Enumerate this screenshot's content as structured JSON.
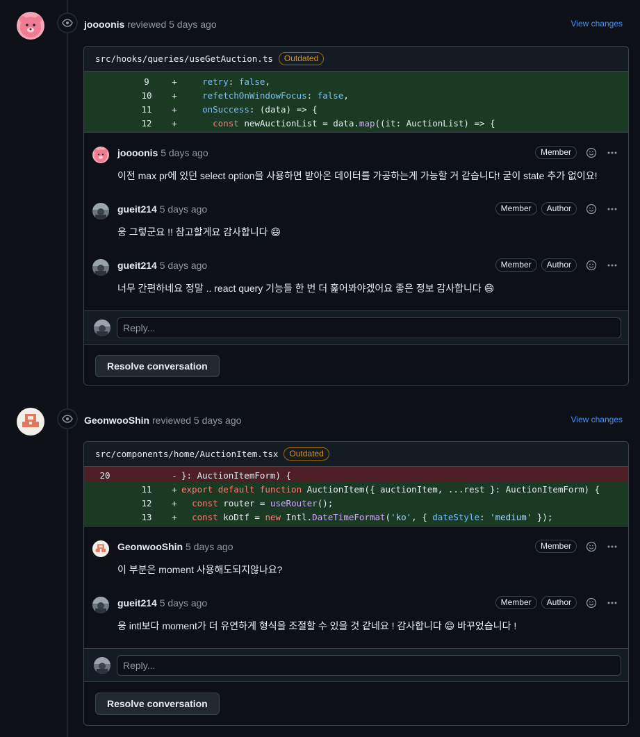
{
  "reviews": [
    {
      "author": "joooonis",
      "action": "reviewed 5 days ago",
      "view_changes": "View changes",
      "file_path": "src/hooks/queries/useGetAuction.ts",
      "outdated_label": "Outdated",
      "diff": [
        {
          "type": "add",
          "old": "",
          "new": "9",
          "sign": "+",
          "code": "    retry: false,"
        },
        {
          "type": "add",
          "old": "",
          "new": "10",
          "sign": "+",
          "code": "    refetchOnWindowFocus: false,"
        },
        {
          "type": "add",
          "old": "",
          "new": "11",
          "sign": "+",
          "code": "    onSuccess: (data) => {"
        },
        {
          "type": "add",
          "old": "",
          "new": "12",
          "sign": "+",
          "code": "      const newAuctionList = data.map((it: AuctionList) => {"
        }
      ],
      "comments": [
        {
          "author": "joooonis",
          "time": "5 days ago",
          "labels": [
            "Member"
          ],
          "body": "이전 max pr에 있던 select option을 사용하면 받아온 데이터를 가공하는게 가능할 거 같습니다! 굳이 state 추가 없이요!"
        },
        {
          "author": "gueit214",
          "time": "5 days ago",
          "labels": [
            "Member",
            "Author"
          ],
          "body": "웅 그렇군요 !! 참고할게요 감사합니다 😄"
        },
        {
          "author": "gueit214",
          "time": "5 days ago",
          "labels": [
            "Member",
            "Author"
          ],
          "body": "너무 간편하네요 정말 .. react query 기능들 한 번 더 훑어봐야겠어요 좋은 정보 감사합니다 😄"
        }
      ],
      "reply_placeholder": "Reply...",
      "resolve_label": "Resolve conversation"
    },
    {
      "author": "GeonwooShin",
      "action": "reviewed 5 days ago",
      "view_changes": "View changes",
      "file_path": "src/components/home/AuctionItem.tsx",
      "outdated_label": "Outdated",
      "diff": [
        {
          "type": "del",
          "old": "20",
          "new": "",
          "sign": "-",
          "code": "}: AuctionItemForm) {"
        },
        {
          "type": "add",
          "old": "",
          "new": "11",
          "sign": "+",
          "code": "export default function AuctionItem({ auctionItem, ...rest }: AuctionItemForm) {"
        },
        {
          "type": "add",
          "old": "",
          "new": "12",
          "sign": "+",
          "code": "  const router = useRouter();"
        },
        {
          "type": "add",
          "old": "",
          "new": "13",
          "sign": "+",
          "code": "  const koDtf = new Intl.DateTimeFormat('ko', { dateStyle: 'medium' });"
        }
      ],
      "comments": [
        {
          "author": "GeonwooShin",
          "time": "5 days ago",
          "labels": [
            "Member"
          ],
          "body": "이 부분은 moment 사용해도되지않나요?"
        },
        {
          "author": "gueit214",
          "time": "5 days ago",
          "labels": [
            "Member",
            "Author"
          ],
          "body": "웅 intl보다 moment가 더 유연하게 형식을 조절할 수 있을 것 같네요 ! 감사합니다 😄 바꾸었습니다 !"
        }
      ],
      "reply_placeholder": "Reply...",
      "resolve_label": "Resolve conversation"
    }
  ],
  "colors": {
    "background": "#0d1117",
    "link": "#4493f8",
    "outdated": "#d29922",
    "diff_add": "#1b3a24",
    "diff_del": "#4b1f24"
  },
  "icons": [
    "eye-icon",
    "smiley-icon",
    "kebab-horizontal-icon"
  ]
}
